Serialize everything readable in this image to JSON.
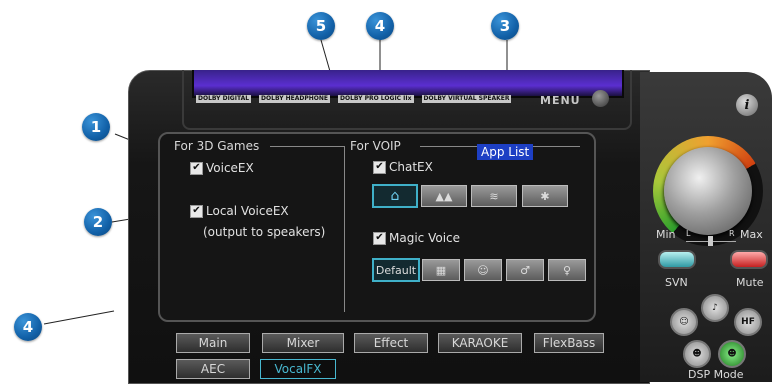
{
  "callouts": {
    "c1": "1",
    "c2": "2",
    "c3": "3",
    "c4_top": "4",
    "c4_left": "4",
    "c5": "5"
  },
  "header": {
    "menu_label": "MENU",
    "logos": [
      "DOLBY DIGITAL",
      "DOLBY HEADPHONE",
      "DOLBY PRO LOGIC IIx",
      "DOLBY VIRTUAL SPEAKER"
    ]
  },
  "info_label": "i",
  "games": {
    "title": "For 3D Games",
    "voiceex": {
      "label": "VoiceEX",
      "checked": true
    },
    "local_voiceex": {
      "label": "Local VoiceEX",
      "checked": true
    },
    "local_note": "(output to speakers)"
  },
  "voip": {
    "title": "For VOIP",
    "app_list": "App List",
    "chatex": {
      "label": "ChatEX",
      "checked": true
    },
    "chatex_icons": [
      "home-icon",
      "crowd-icon",
      "wind-icon",
      "figure-icon"
    ],
    "magic_voice": {
      "label": "Magic Voice",
      "checked": true
    },
    "magic_default": "Default",
    "magic_icons": [
      "robot-icon",
      "face-icon",
      "male-icon",
      "female-icon"
    ]
  },
  "tabs": [
    {
      "label": "Main",
      "selected": false
    },
    {
      "label": "Mixer",
      "selected": false
    },
    {
      "label": "Effect",
      "selected": false
    },
    {
      "label": "KARAOKE",
      "selected": false
    },
    {
      "label": "FlexBass",
      "selected": false
    },
    {
      "label": "AEC",
      "selected": false
    },
    {
      "label": "VocalFX",
      "selected": true
    }
  ],
  "right": {
    "min": "Min",
    "max": "Max",
    "l": "L",
    "r": "R",
    "svn": "SVN",
    "mute": "Mute",
    "dsp_mode": "DSP Mode",
    "dsp_buttons": [
      "ghost-icon",
      "note-icon",
      "HF",
      "face-icon",
      "green-face-icon"
    ]
  },
  "colors": {
    "accent": "#48b8d0",
    "callout": "#1261a8",
    "app_list_bg": "#1d3fc4"
  }
}
